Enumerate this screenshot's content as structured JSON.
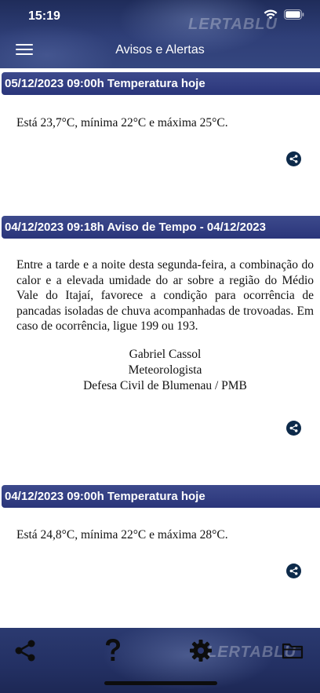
{
  "status_bar": {
    "time": "15:19",
    "icons": [
      "wifi-icon",
      "battery-icon"
    ]
  },
  "header": {
    "title": "Avisos e Alertas",
    "watermark": "LERTABLU",
    "menu_icon": "hamburger-menu-icon"
  },
  "notices": [
    {
      "header": "05/12/2023 09:00h Temperatura hoje",
      "body": "Está 23,7°C, mínima 22°C e máxima 25°C."
    },
    {
      "header": "04/12/2023 09:18h Aviso de Tempo - 04/12/2023",
      "body": "Entre a tarde e a noite desta segunda-feira, a combinação do calor e a elevada umidade do ar sobre a região do Médio Vale do Itajaí, favorece a condição para ocorrência de pancadas isoladas de chuva acompanhadas de trovoadas. Em caso de ocorrência, ligue 199 ou 193.",
      "signature": [
        "Gabriel Cassol",
        "Meteorologista",
        "Defesa Civil de Blumenau / PMB"
      ]
    },
    {
      "header": "04/12/2023 09:00h Temperatura hoje",
      "body": "Está 24,8°C, mínima 22°C e máxima 28°C."
    }
  ],
  "bottom_bar": {
    "watermark": "LERTABLU",
    "tabs": [
      "share-icon",
      "help-icon",
      "settings-icon",
      "folder-icon"
    ]
  },
  "colors": {
    "bar_dark": "#1f2c5a",
    "notice_header": "#2a357a",
    "share_button": "#0d2a4a"
  }
}
